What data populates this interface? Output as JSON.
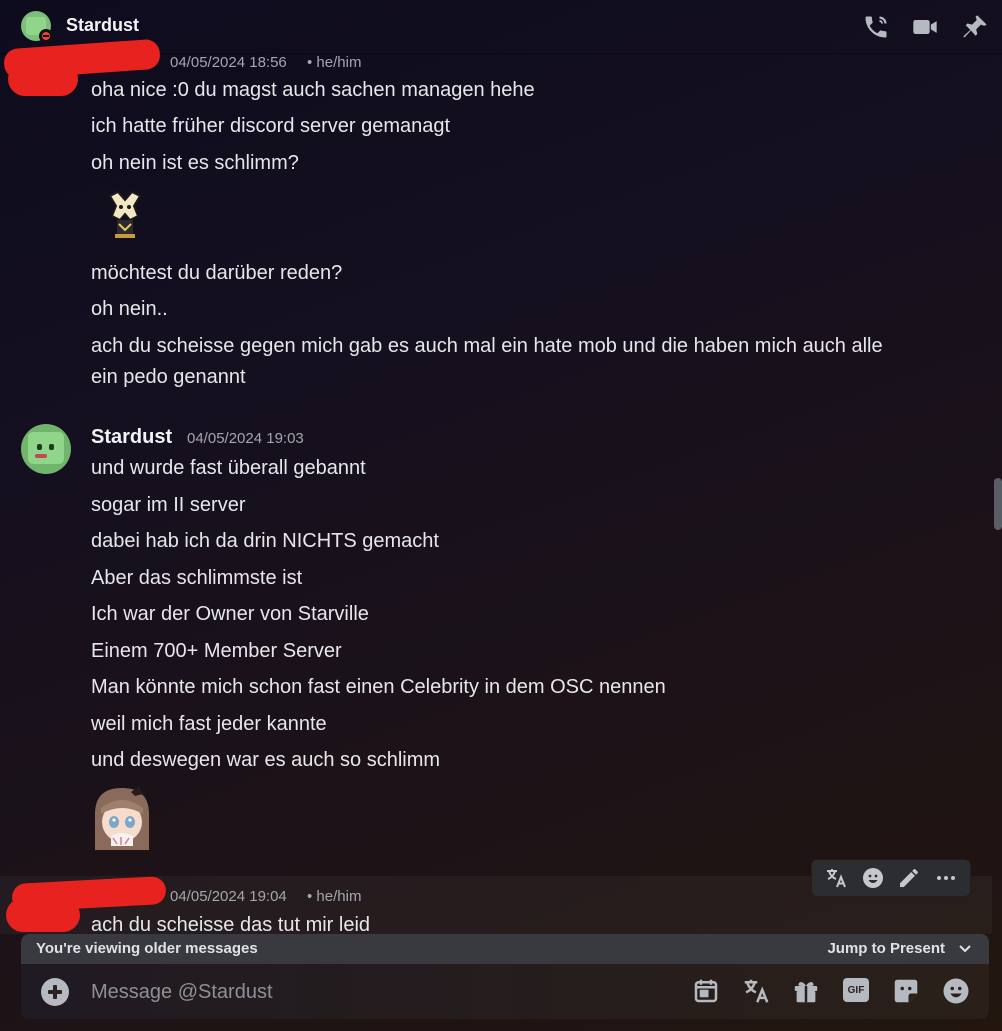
{
  "header": {
    "title": "Stardust",
    "status": "do-not-disturb",
    "icons": [
      "phone-call-icon",
      "video-call-icon",
      "pin-icon"
    ]
  },
  "messages": {
    "group1": {
      "timestamp": "04/05/2024 18:56",
      "pronouns": "• he/him",
      "lines": [
        "oha nice :0 du magst auch sachen managen hehe",
        "ich hatte früher discord server gemanagt",
        "oh nein ist es schlimm?",
        "möchtest du darüber reden?",
        "oh nein..",
        "ach du scheisse gegen mich gab es auch mal ein hate mob und die haben mich auch alle",
        "ein pedo genannt"
      ]
    },
    "group2": {
      "author": "Stardust",
      "timestamp": "04/05/2024 19:03",
      "lines": [
        "und wurde fast überall gebannt",
        "sogar im II server",
        "dabei hab ich da drin NICHTS gemacht",
        "Aber das schlimmste ist",
        "Ich war der Owner von Starville",
        "Einem 700+ Member Server",
        "Man könnte mich schon fast einen Celebrity in dem OSC nennen",
        "weil mich fast jeder kannte",
        "und deswegen war es auch so schlimm"
      ]
    },
    "group3": {
      "timestamp": "04/05/2024 19:04",
      "pronouns": "• he/him",
      "lines": [
        "ach du scheisse das tut mir leid"
      ]
    }
  },
  "hover_toolbar": [
    "translate-icon",
    "emoji-reaction-icon",
    "edit-icon",
    "more-icon"
  ],
  "older_bar": {
    "text": "You're viewing older messages",
    "jump_label": "Jump to Present"
  },
  "composer": {
    "placeholder": "Message @Stardust",
    "gif_label": "GIF",
    "icons": [
      "add-icon",
      "calendar-icon",
      "translate-icon",
      "gift-icon",
      "gif-icon",
      "sticker-icon",
      "emoji-icon"
    ]
  },
  "colors": {
    "redaction": "#e8231f",
    "dnd_status": "#f23f43"
  }
}
